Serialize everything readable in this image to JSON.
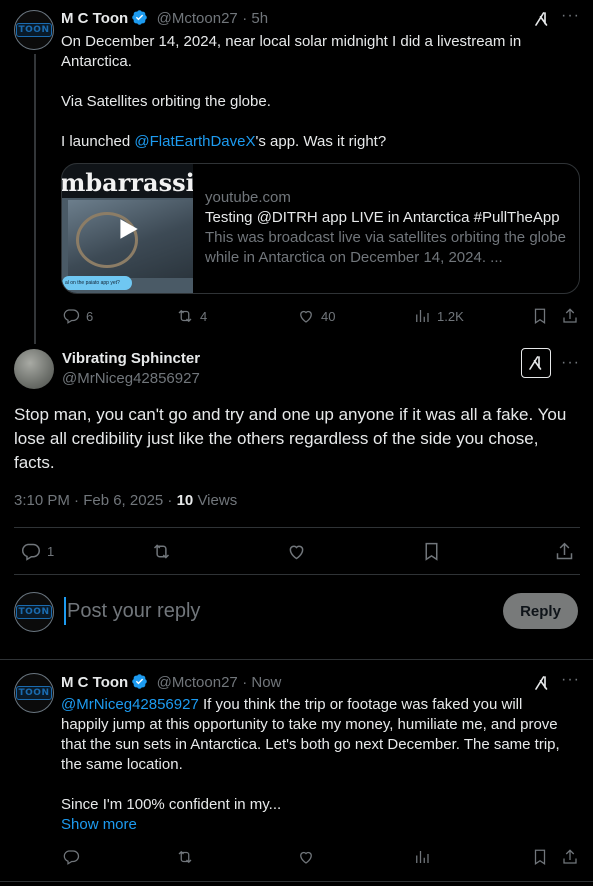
{
  "post1": {
    "name": "M C Toon",
    "handle": "@Mctoon27",
    "time": "· 5h",
    "avatar_text": "TOON",
    "line1": "On December 14, 2024, near local solar midnight I did a livestream in Antarctica.",
    "line2": "Via Satellites orbiting the globe.",
    "line3_pre": "I launched ",
    "line3_link": "@FlatEarthDaveX",
    "line3_post": "'s app.  Was it right?",
    "card": {
      "thumb_text": "mbarrassin",
      "thumb_caption": "al on the paiato app yet?",
      "domain": "youtube.com",
      "title": "Testing @DITRH app LIVE in Antarctica #PullTheApp",
      "desc": "This was broadcast live via satellites orbiting the globe while in Antarctica on December 14, 2024. ..."
    },
    "replies": "6",
    "reposts": "4",
    "likes": "40",
    "views": "1.2K"
  },
  "post2": {
    "name": "Vibrating Sphincter",
    "handle": "@MrNiceg42856927",
    "body": "Stop man, you can't go and try and one up anyone if it was all a fake. You lose all credibility just like the others regardless of the side you chose, facts.",
    "timestamp": "3:10 PM · Feb 6, 2025 · ",
    "views_count": "10",
    "views_label": " Views",
    "replies": "1"
  },
  "reply_box": {
    "avatar_text": "TOON",
    "placeholder": "Post your reply",
    "button": "Reply"
  },
  "post3": {
    "name": "M C Toon",
    "handle": "@Mctoon27",
    "time": "· Now",
    "avatar_text": "TOON",
    "mention": "@MrNiceg42856927",
    "body": " If you think the trip or footage was faked you will happily jump at this opportunity to take my money, humiliate me, and prove that the sun sets in Antarctica.  Let's both go next December.  The same trip, the same location.",
    "body2": "Since I'm 100% confident in my...",
    "show_more": "Show more"
  },
  "colors": {
    "accent": "#1d9bf0",
    "muted": "#71767b",
    "divider": "#2f3336"
  },
  "icons": [
    "verified-badge-icon",
    "grok-icon",
    "more-icon",
    "play-icon",
    "reply-icon",
    "repost-icon",
    "like-icon",
    "views-icon",
    "bookmark-icon",
    "share-icon"
  ]
}
